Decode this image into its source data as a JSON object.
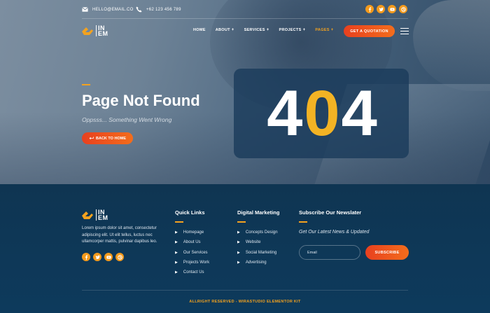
{
  "topbar": {
    "email": "HELLO@EMAIL.CO",
    "phone": "+62 123 456 789",
    "social_icons": [
      "facebook-icon",
      "twitter-icon",
      "youtube-icon",
      "dribbble-icon"
    ]
  },
  "brand": {
    "logo_text_top": "IN",
    "logo_text_bottom": "EM"
  },
  "nav": {
    "items": [
      {
        "label": "HOME",
        "has_caret": false
      },
      {
        "label": "ABOUT",
        "has_caret": true
      },
      {
        "label": "SERVICES",
        "has_caret": true
      },
      {
        "label": "PROJECTS",
        "has_caret": true
      },
      {
        "label": "PAGES",
        "has_caret": true,
        "active": true
      }
    ],
    "cta": "GET A QUOTATION"
  },
  "hero": {
    "title": "Page Not Found",
    "subtitle": "Oppsss... Something Went Wrong",
    "button": "BACK TO HOME",
    "code_left": "4",
    "code_mid": "0",
    "code_right": "4"
  },
  "footer": {
    "about": "Lorem ipsum dolor sit amet, consectetur adipiscing elit. Ut elit tellus, luctus nec ullamcorper mattis, pulvinar dapibus leo.",
    "quick_links_title": "Quick Links",
    "quick_links": [
      "Homepage",
      "About Us",
      "Our Services",
      "Projects Work",
      "Contact Us"
    ],
    "marketing_title": "Digital Marketing",
    "marketing_links": [
      "Concepts Design",
      "Website",
      "Social Marketing",
      "Advertising"
    ],
    "newsletter_title": "Subscribe Our Newslater",
    "newsletter_sub": "Get Our Latest News & Updated",
    "email_placeholder": "Email",
    "subscribe": "SUBSCRIBE",
    "copyright": "ALLRIGHT RESERVED - WIRASTUDIO ELEMENTOR KIT"
  },
  "colors": {
    "accent": "#f3a21f",
    "cta": "#e8401f",
    "footer_bg": "#0f3552"
  }
}
